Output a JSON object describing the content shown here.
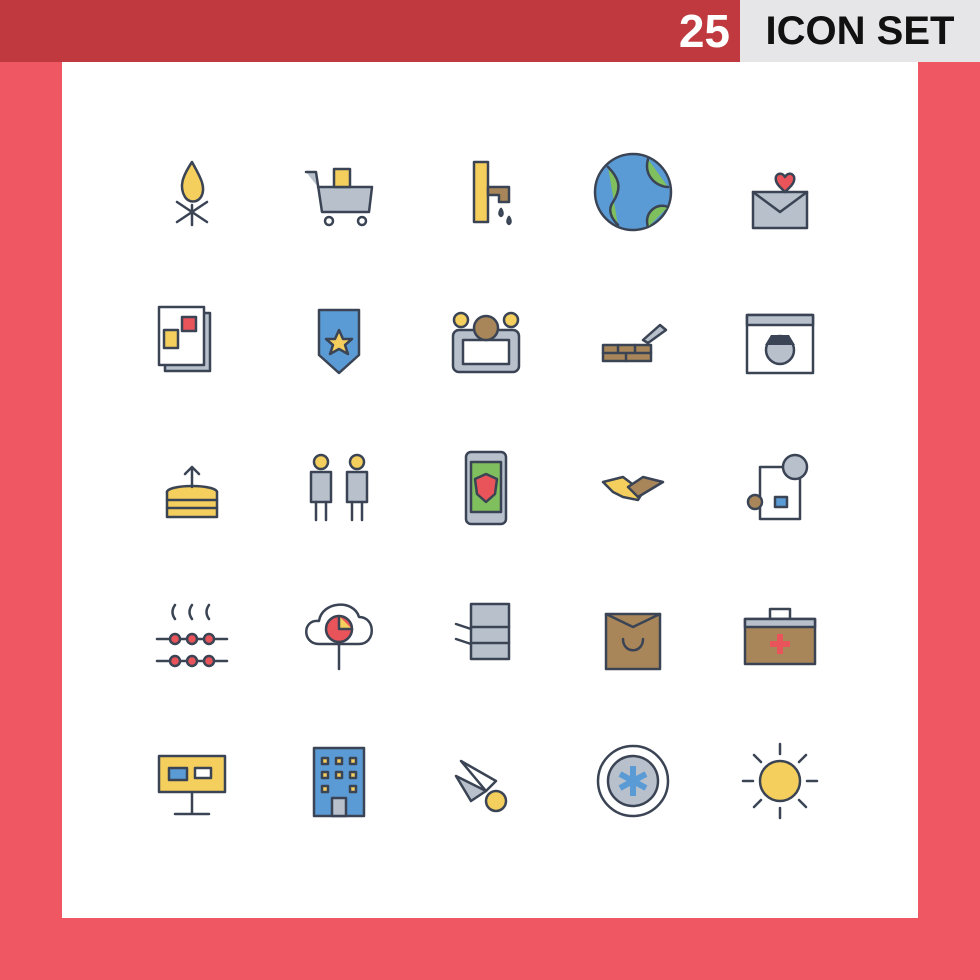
{
  "header": {
    "count": "25",
    "title": "ICON SET"
  },
  "colors": {
    "background": "#ef5763",
    "banner": "#c0393f",
    "title_box": "#e6e6e8",
    "outline": "#3a4454",
    "yellow": "#f5cf5d",
    "blue": "#5b9bd5",
    "green": "#7fbf5e",
    "red": "#e8545a",
    "tan": "#a9865a",
    "gray": "#b8c0cc"
  },
  "icons": [
    "campfire-icon",
    "shopping-cart-icon",
    "water-tap-icon",
    "earth-globe-icon",
    "love-letter-icon",
    "jobs-newspaper-icon",
    "police-badge-icon",
    "mobile-settings-icon",
    "brick-wall-trowel-icon",
    "hacker-browser-icon",
    "database-upload-icon",
    "people-scissors-icon",
    "mobile-shield-icon",
    "handshake-icon",
    "document-clock-icon",
    "steam-abacus-icon",
    "pie-chart-cloud-icon",
    "printer-copier-icon",
    "shopping-bag-icon",
    "first-aid-kit-icon",
    "billboard-icon",
    "office-building-icon",
    "shuttlecock-icon",
    "medical-sign-icon",
    "sun-icon"
  ]
}
